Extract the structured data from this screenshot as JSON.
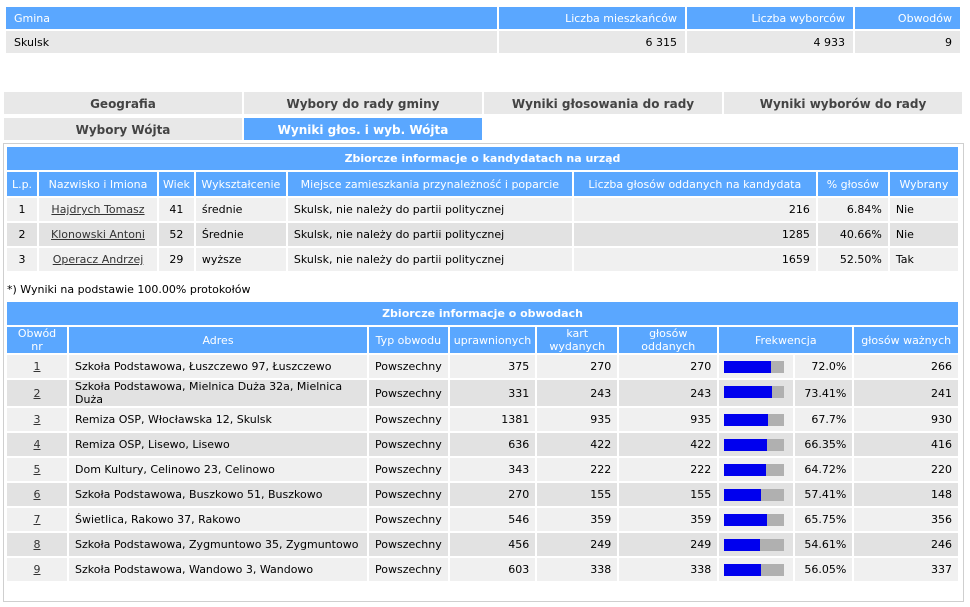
{
  "gmina_table": {
    "headers": [
      "Gmina",
      "Liczba mieszkańców",
      "Liczba wyborców",
      "Obwodów"
    ],
    "row": {
      "gmina": "Skulsk",
      "mieszkancy": "6 315",
      "wyborcy": "4 933",
      "obwodow": "9"
    }
  },
  "tabs": [
    {
      "label": "Geografia",
      "active": false
    },
    {
      "label": "Wybory do rady gminy",
      "active": false
    },
    {
      "label": "Wyniki głosowania do rady",
      "active": false
    },
    {
      "label": "Wyniki wyborów do rady",
      "active": false
    },
    {
      "label": "Wybory Wójta",
      "active": false
    },
    {
      "label": "Wyniki głos. i wyb. Wójta",
      "active": true
    }
  ],
  "candidates": {
    "title": "Zbiorcze informacje o kandydatach na urząd",
    "headers": [
      "L.p.",
      "Nazwisko i Imiona",
      "Wiek",
      "Wykształcenie",
      "Miejsce zamieszkania przynależność i poparcie",
      "Liczba głosów oddanych na kandydata",
      "% głosów",
      "Wybrany"
    ],
    "rows": [
      {
        "lp": "1",
        "name": "Hajdrych Tomasz",
        "age": "41",
        "edu": "średnie",
        "place": "Skulsk, nie należy do partii politycznej",
        "votes": "216",
        "pct": "6.84%",
        "elected": "Nie"
      },
      {
        "lp": "2",
        "name": "Klonowski Antoni",
        "age": "52",
        "edu": "Średnie",
        "place": "Skulsk, nie należy do partii politycznej",
        "votes": "1285",
        "pct": "40.66%",
        "elected": "Nie"
      },
      {
        "lp": "3",
        "name": "Operacz Andrzej",
        "age": "29",
        "edu": "wyższe",
        "place": "Skulsk, nie należy do partii politycznej",
        "votes": "1659",
        "pct": "52.50%",
        "elected": "Tak"
      }
    ],
    "note": "*) Wyniki na podstawie 100.00% protokołów"
  },
  "obwody": {
    "title": "Zbiorcze informacje o obwodach",
    "headers": [
      "Obwód nr",
      "Adres",
      "Typ obwodu",
      "uprawnionych",
      "kart wydanych",
      "głosów oddanych",
      "Frekwencja",
      "głosów ważnych"
    ],
    "rows": [
      {
        "nr": "1",
        "adres": "Szkoła Podstawowa, Łuszczewo 97, Łuszczewo",
        "typ": "Powszechny",
        "upr": "375",
        "kart": "270",
        "oddanych": "270",
        "frek": "72.0%",
        "frek_value": 72.0,
        "wazne": "266"
      },
      {
        "nr": "2",
        "adres": "Szkoła Podstawowa, Mielnica Duża 32a, Mielnica Duża",
        "typ": "Powszechny",
        "upr": "331",
        "kart": "243",
        "oddanych": "243",
        "frek": "73.41%",
        "frek_value": 73.41,
        "wazne": "241"
      },
      {
        "nr": "3",
        "adres": "Remiza OSP, Włocławska 12, Skulsk",
        "typ": "Powszechny",
        "upr": "1381",
        "kart": "935",
        "oddanych": "935",
        "frek": "67.7%",
        "frek_value": 67.7,
        "wazne": "930"
      },
      {
        "nr": "4",
        "adres": "Remiza OSP, Lisewo, Lisewo",
        "typ": "Powszechny",
        "upr": "636",
        "kart": "422",
        "oddanych": "422",
        "frek": "66.35%",
        "frek_value": 66.35,
        "wazne": "416"
      },
      {
        "nr": "5",
        "adres": "Dom Kultury, Celinowo 23, Celinowo",
        "typ": "Powszechny",
        "upr": "343",
        "kart": "222",
        "oddanych": "222",
        "frek": "64.72%",
        "frek_value": 64.72,
        "wazne": "220"
      },
      {
        "nr": "6",
        "adres": "Szkoła Podstawowa, Buszkowo 51, Buszkowo",
        "typ": "Powszechny",
        "upr": "270",
        "kart": "155",
        "oddanych": "155",
        "frek": "57.41%",
        "frek_value": 57.41,
        "wazne": "148"
      },
      {
        "nr": "7",
        "adres": "Świetlica, Rakowo 37, Rakowo",
        "typ": "Powszechny",
        "upr": "546",
        "kart": "359",
        "oddanych": "359",
        "frek": "65.75%",
        "frek_value": 65.75,
        "wazne": "356"
      },
      {
        "nr": "8",
        "adres": "Szkoła Podstawowa, Zygmuntowo 35, Zygmuntowo",
        "typ": "Powszechny",
        "upr": "456",
        "kart": "249",
        "oddanych": "249",
        "frek": "54.61%",
        "frek_value": 54.61,
        "wazne": "246"
      },
      {
        "nr": "9",
        "adres": "Szkoła Podstawowa, Wandowo 3, Wandowo",
        "typ": "Powszechny",
        "upr": "603",
        "kart": "338",
        "oddanych": "338",
        "frek": "56.05%",
        "frek_value": 56.05,
        "wazne": "337"
      }
    ]
  },
  "colors": {
    "header_blue": "#5aa7ff",
    "bar_fill": "#0000ee",
    "bar_bg": "#b0b0b0"
  }
}
